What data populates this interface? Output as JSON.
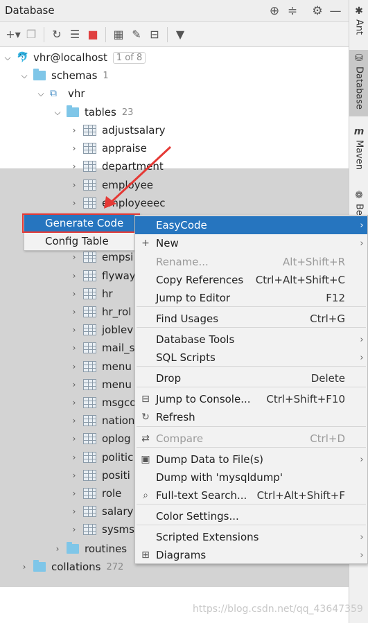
{
  "titlebar": {
    "title": "Database"
  },
  "tree": {
    "connection": {
      "label": "vhr@localhost",
      "badge": "1 of 8"
    },
    "schemas": {
      "label": "schemas",
      "count": "1"
    },
    "schema_vhr": {
      "label": "vhr"
    },
    "tables": {
      "label": "tables",
      "count": "23"
    },
    "table_items": [
      "adjustsalary",
      "appraise",
      "department",
      "employee",
      "employeeec",
      "",
      "",
      "empsi",
      "flyway",
      "hr",
      "hr_rol",
      "joblev",
      "mail_s",
      "menu",
      "menu",
      "msgco",
      "nation",
      "oplog",
      "politic",
      "positi",
      "role",
      "salary",
      "sysms"
    ],
    "routines": {
      "label": "routines"
    },
    "collations": {
      "label": "collations",
      "count": "272"
    }
  },
  "sidebar": {
    "tabs": [
      "Ant",
      "Database",
      "Maven",
      "Be"
    ]
  },
  "left_popup": {
    "items": [
      "Generate Code",
      "Config Table"
    ]
  },
  "context_menu": {
    "items": [
      {
        "label": "EasyCode",
        "shortcut": "",
        "submenu": true
      },
      {
        "label": "New",
        "shortcut": "",
        "submenu": true
      },
      {
        "label": "Rename...",
        "shortcut": "Alt+Shift+R"
      },
      {
        "label": "Copy References",
        "shortcut": "Ctrl+Alt+Shift+C"
      },
      {
        "label": "Jump to Editor",
        "shortcut": "F12"
      },
      {
        "label": "Find Usages",
        "shortcut": "Ctrl+G"
      },
      {
        "label": "Database Tools",
        "shortcut": "",
        "submenu": true
      },
      {
        "label": "SQL Scripts",
        "shortcut": "",
        "submenu": true
      },
      {
        "label": "Drop",
        "shortcut": "Delete"
      },
      {
        "label": "Jump to Console...",
        "shortcut": "Ctrl+Shift+F10"
      },
      {
        "label": "Refresh",
        "shortcut": ""
      },
      {
        "label": "Compare",
        "shortcut": "Ctrl+D"
      },
      {
        "label": "Dump Data to File(s)",
        "shortcut": "",
        "submenu": true
      },
      {
        "label": "Dump with 'mysqldump'",
        "shortcut": ""
      },
      {
        "label": "Full-text Search...",
        "shortcut": "Ctrl+Alt+Shift+F"
      },
      {
        "label": "Color Settings...",
        "shortcut": ""
      },
      {
        "label": "Scripted Extensions",
        "shortcut": "",
        "submenu": true
      },
      {
        "label": "Diagrams",
        "shortcut": "",
        "submenu": true
      }
    ]
  },
  "watermark": "https://blog.csdn.net/qq_43647359",
  "colors": {
    "selection": "#2675bf",
    "highlight_box": "#e53935",
    "folder": "#7fc6e8"
  }
}
